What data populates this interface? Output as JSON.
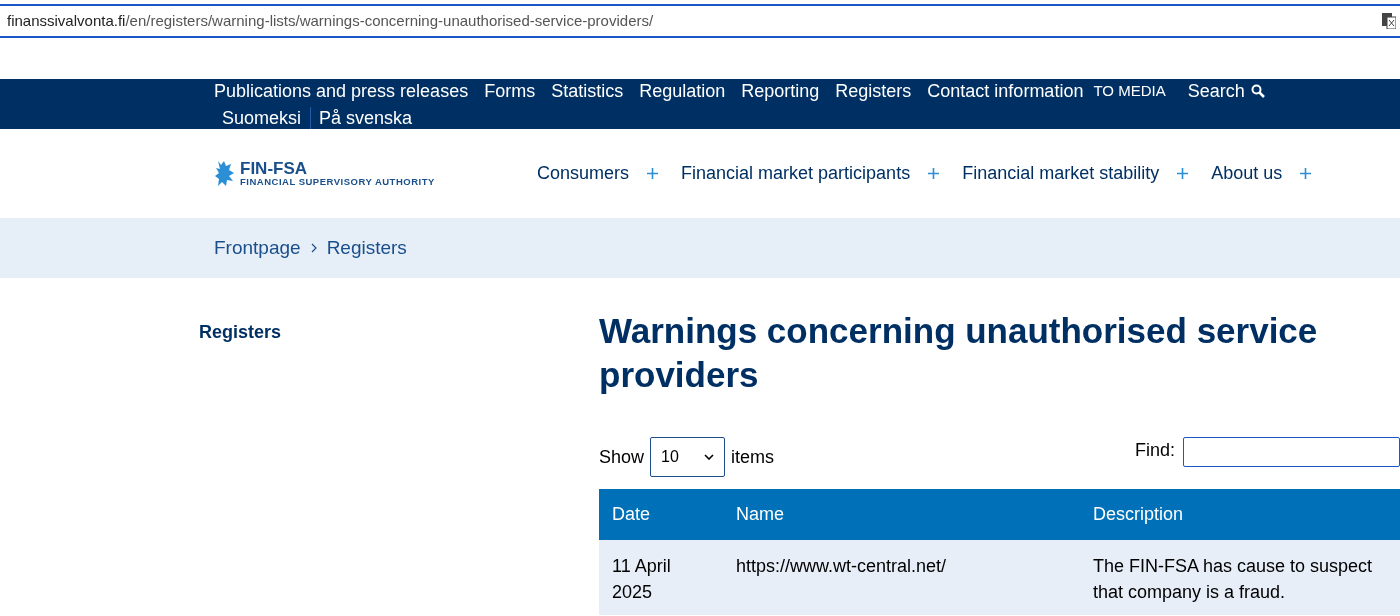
{
  "address_bar": {
    "domain": "finanssivalvonta.fi",
    "path": "/en/registers/warning-lists/warnings-concerning-unauthorised-service-providers/"
  },
  "top_nav": {
    "links": [
      "Publications and press releases",
      "Forms",
      "Statistics",
      "Regulation",
      "Reporting",
      "Registers",
      "Contact information"
    ],
    "media": "TO MEDIA",
    "search": "Search",
    "languages": [
      "Suomeksi",
      "På svenska"
    ]
  },
  "logo": {
    "name": "FIN-FSA",
    "subtitle": "FINANCIAL SUPERVISORY AUTHORITY"
  },
  "main_nav": [
    {
      "label": "Consumers",
      "expanded": false
    },
    {
      "label": "Financial market participants",
      "expanded": false
    },
    {
      "label": "Financial market stability",
      "expanded": false
    },
    {
      "label": "About us",
      "expanded": false
    }
  ],
  "breadcrumb": [
    "Frontpage",
    "Registers"
  ],
  "sidebar": {
    "title": "Registers"
  },
  "page_title": "Warnings concerning unauthorised service providers",
  "table_controls": {
    "show_label": "Show",
    "page_size": "10",
    "items_label": "items",
    "find_label": "Find:"
  },
  "table": {
    "columns": [
      "Date",
      "Name",
      "Description"
    ],
    "rows": [
      [
        "11 April 2025",
        "https://www.wt-central.net/",
        "The FIN-FSA has cause to suspect that company is a fraud."
      ]
    ]
  }
}
